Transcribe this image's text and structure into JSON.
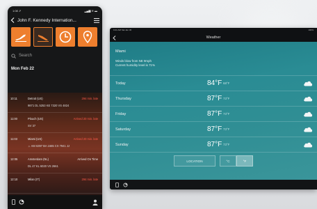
{
  "phone": {
    "status_time": "1:08 ⇗",
    "status_right": "▂▄▆ ≋ ▬",
    "back_icon": "chevron-left-icon",
    "title": "John F. Kennedy Internation...",
    "menu_icon": "menu-icon",
    "tiles": [
      {
        "icon": "departures-icon"
      },
      {
        "icon": "arrivals-icon"
      },
      {
        "icon": "clock-icon"
      },
      {
        "icon": "location-pin-icon"
      }
    ],
    "search_placeholder": "Search",
    "date": "Mon Feb 22",
    "flights": [
      {
        "time": "10:11",
        "dest": "Detroit (US)",
        "status": "294 min. late",
        "codes": "9871  DL 5253  KE 7320  VS 4824",
        "late": true
      },
      {
        "time": "11:00",
        "dest": "Plouch (US)",
        "status": "Arrived 20 min. late",
        "codes": "SV 37",
        "late": true
      },
      {
        "time": "11:03",
        "dest": "Miami (US)",
        "status": "Arrived 20 min. late",
        "codes": "☼ AM 6397  BA 1665  CX 7941  JJ",
        "late": true
      },
      {
        "time": "12:05",
        "dest": "Amsterdam (NL)",
        "status": "Arrived On Time",
        "codes": "DL 47  KL 6020  VS 2661",
        "late": false
      },
      {
        "time": "12:10",
        "dest": "Milan (IT)",
        "status": "294 min. late",
        "codes": "",
        "late": true
      }
    ]
  },
  "tablet": {
    "status_left": "9:41 AM  Sat Jan 30",
    "status_right": "100%",
    "title": "Weather",
    "city": "Miami",
    "description": [
      "Winds blow from NE 9mph",
      "Current humidity level is 71%"
    ],
    "days": [
      {
        "name": "Today",
        "high": "84°F",
        "low": "68°F"
      },
      {
        "name": "Thursday",
        "high": "87°F",
        "low": "73°F"
      },
      {
        "name": "Friday",
        "high": "87°F",
        "low": "73°F"
      },
      {
        "name": "Saturday",
        "high": "87°F",
        "low": "73°F"
      },
      {
        "name": "Sunday",
        "high": "87°F",
        "low": "73°F"
      }
    ],
    "location_label": "LOCATION",
    "unit_c": "°C",
    "unit_f": "°F"
  }
}
